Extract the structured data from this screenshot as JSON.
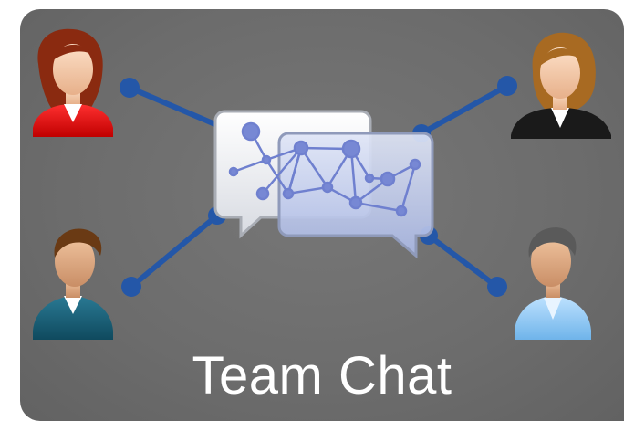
{
  "title": "Team Chat",
  "colors": {
    "background": "#6c6c6c",
    "connector": "#2457a8",
    "bubble_front": "#b8c4e6",
    "bubble_back": "#eceef3",
    "network": "#7f8fd6",
    "title_text": "#ffffff"
  },
  "icons": [
    "woman-red-shirt-avatar-icon",
    "woman-black-suit-avatar-icon",
    "man-teal-sweater-avatar-icon",
    "man-blue-shirt-avatar-icon",
    "chat-bubbles-network-icon"
  ]
}
